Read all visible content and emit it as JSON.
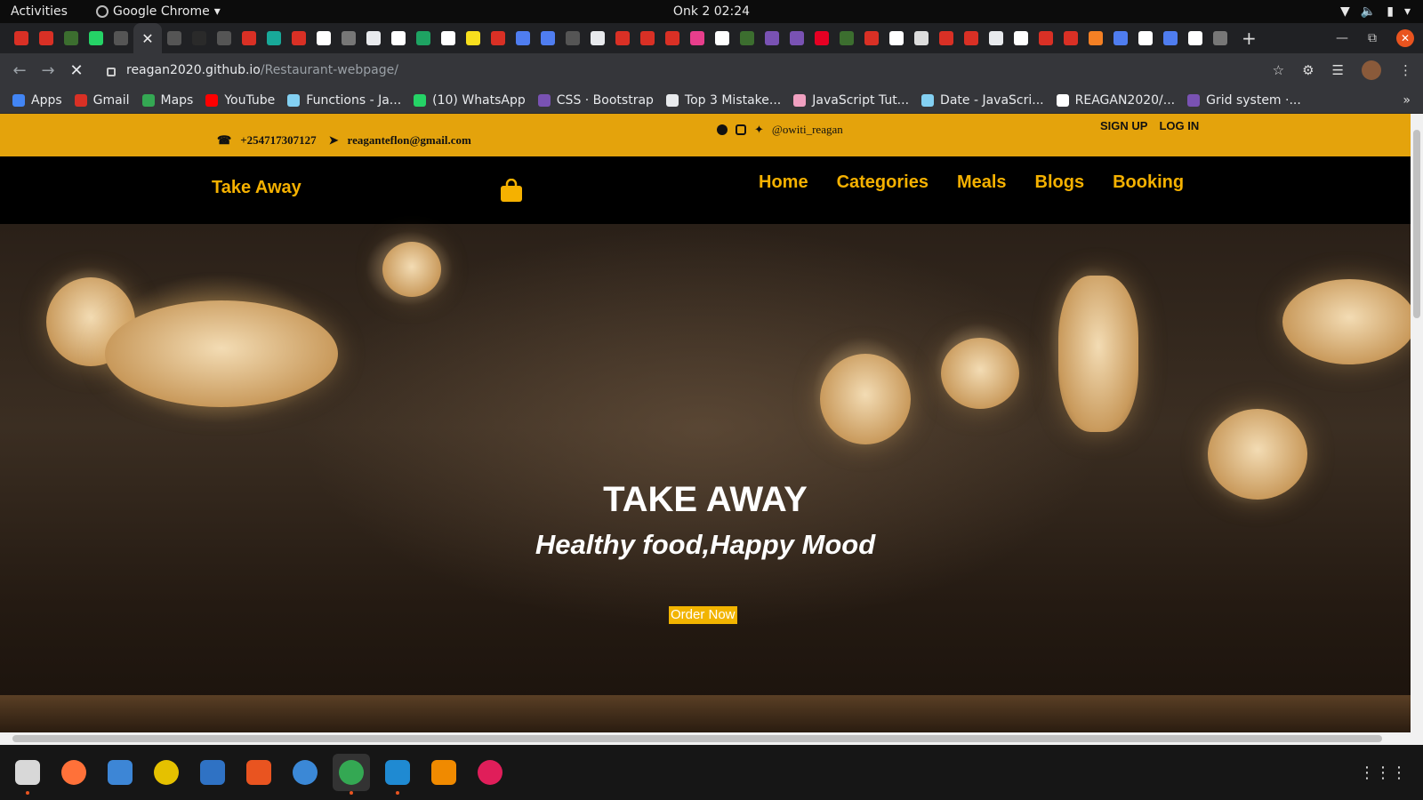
{
  "system_bar": {
    "activities": "Activities",
    "app_name": "Google Chrome",
    "clock": "Onk 2  02:24"
  },
  "browser": {
    "url_host": "reagan2020.github.io",
    "url_path": "/Restaurant-webpage/",
    "tab_favicon_colors": [
      "#d93025",
      "#d93025",
      "#3c6e2f",
      "#25d366",
      "#555",
      "#555",
      "#2a2a2a",
      "#555",
      "#d93025",
      "#18a999",
      "#d93025",
      "#fff",
      "#777",
      "#e8eaed",
      "#fff",
      "#1ea362",
      "#fff",
      "#f7df1e",
      "#d93025",
      "#4f7df0",
      "#4f7df0",
      "#555",
      "#e8eaed",
      "#d93025",
      "#d93025",
      "#d93025",
      "#e83e8c",
      "#fff",
      "#3c6e2f",
      "#7952b3",
      "#7952b3",
      "#e60023",
      "#3c6e2f",
      "#d93025",
      "#fff",
      "#ddd",
      "#d93025",
      "#d93025",
      "#e8eaed",
      "#fff",
      "#d93025",
      "#d93025",
      "#f48024",
      "#4f7df0",
      "#fff",
      "#4f7df0",
      "#fff",
      "#777"
    ],
    "bookmarks": [
      {
        "label": "Apps",
        "icon": "apps-grid-icon",
        "color": "#4285f4"
      },
      {
        "label": "Gmail",
        "icon": "gmail-icon",
        "color": "#d93025"
      },
      {
        "label": "Maps",
        "icon": "maps-icon",
        "color": "#34a853"
      },
      {
        "label": "YouTube",
        "icon": "youtube-icon",
        "color": "#ff0000"
      },
      {
        "label": "Functions - Ja...",
        "icon": "mdn-icon",
        "color": "#83d0f2"
      },
      {
        "label": "(10) WhatsApp",
        "icon": "whatsapp-icon",
        "color": "#25d366"
      },
      {
        "label": "CSS · Bootstrap",
        "icon": "bootstrap-icon",
        "color": "#7952b3"
      },
      {
        "label": "Top 3 Mistake...",
        "icon": "w3-icon",
        "color": "#e8eaed"
      },
      {
        "label": "JavaScript Tut...",
        "icon": "javascript-tutorial-icon",
        "color": "#f0a0c0"
      },
      {
        "label": "Date - JavaScri...",
        "icon": "mdn-icon",
        "color": "#83d0f2"
      },
      {
        "label": "REAGAN2020/...",
        "icon": "github-icon",
        "color": "#ffffff"
      },
      {
        "label": "Grid system ·...",
        "icon": "bootstrap-icon",
        "color": "#7952b3"
      }
    ]
  },
  "site": {
    "phone": "+254717307127",
    "email": "reaganteflon@gmail.com",
    "handle": "@owiti_reagan",
    "signup": "SIGN UP",
    "login": "LOG IN",
    "brand": "Take Away",
    "menu": [
      "Home",
      "Categories",
      "Meals",
      "Blogs",
      "Booking"
    ],
    "hero_title": "TAKE AWAY",
    "hero_subtitle": "Healthy food,Happy Mood",
    "order_button": "Order Now",
    "accent_color": "#f5b100",
    "strip_color": "#e4a30c"
  },
  "dock": [
    {
      "icon": "files-icon",
      "color": "#d8d8d8",
      "running": true
    },
    {
      "icon": "firefox-icon",
      "color": "#ff7139",
      "running": false
    },
    {
      "icon": "thunderbird-icon",
      "color": "#3d86d6",
      "running": false
    },
    {
      "icon": "rhythmbox-icon",
      "color": "#e5c100",
      "running": false
    },
    {
      "icon": "libreoffice-writer-icon",
      "color": "#2f72c4",
      "running": false
    },
    {
      "icon": "software-center-icon",
      "color": "#e95420",
      "running": false
    },
    {
      "icon": "help-icon",
      "color": "#3b88d6",
      "running": false
    },
    {
      "icon": "chrome-icon",
      "color": "#34a853",
      "running": true
    },
    {
      "icon": "vscode-icon",
      "color": "#1f8ad2",
      "running": true
    },
    {
      "icon": "vlc-icon",
      "color": "#f08a00",
      "running": false
    },
    {
      "icon": "slack-icon",
      "color": "#e01e5a",
      "running": false
    }
  ]
}
